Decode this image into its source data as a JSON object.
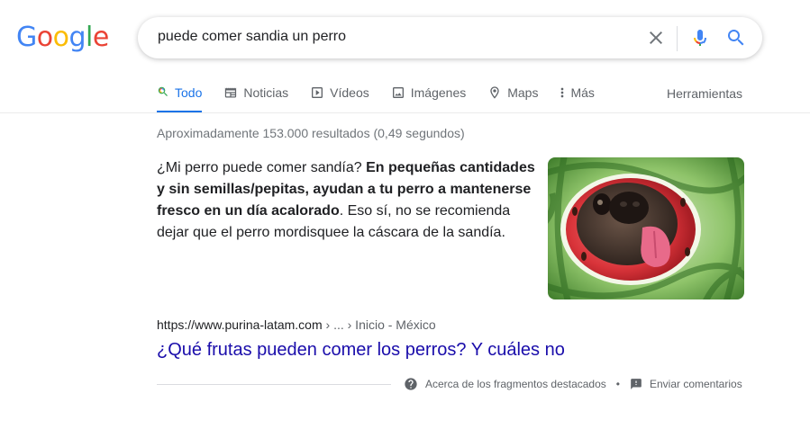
{
  "logo": {
    "text": "Google",
    "letters": [
      {
        "ch": "G",
        "color": "#4285F4"
      },
      {
        "ch": "o",
        "color": "#EA4335"
      },
      {
        "ch": "o",
        "color": "#FBBC05"
      },
      {
        "ch": "g",
        "color": "#4285F4"
      },
      {
        "ch": "l",
        "color": "#34A853"
      },
      {
        "ch": "e",
        "color": "#EA4335"
      }
    ]
  },
  "search": {
    "query": "puede comer sandia un perro"
  },
  "tabs": [
    {
      "label": "Todo",
      "icon": "search-icon",
      "active": true
    },
    {
      "label": "Noticias",
      "icon": "news-icon",
      "active": false
    },
    {
      "label": "Vídeos",
      "icon": "video-icon",
      "active": false
    },
    {
      "label": "Imágenes",
      "icon": "image-icon",
      "active": false
    },
    {
      "label": "Maps",
      "icon": "map-pin-icon",
      "active": false
    },
    {
      "label": "Más",
      "icon": "more-vert-icon",
      "active": false
    }
  ],
  "tools_label": "Herramientas",
  "stats": "Aproximadamente 153.000 resultados (0,49 segundos)",
  "snippet": {
    "lead": "¿Mi perro puede comer sandía? ",
    "bold": "En pequeñas cantidades y sin semillas/pepitas, ayudan a tu perro a mantenerse fresco en un día acalorado",
    "tail": ". Eso sí, no se recomienda dejar que el perro mordisquee la cáscara de la sandía."
  },
  "thumbnail": {
    "icon": "dog-in-watermelon-image"
  },
  "result": {
    "url": "https://www.purina-latam.com",
    "crumbs": " › ... › Inicio - México",
    "title": "¿Qué frutas pueden comer los perros? Y cuáles no"
  },
  "footer": {
    "about_label": "Acerca de los fragmentos destacados",
    "separator": "•",
    "feedback_label": "Enviar comentarios"
  },
  "colors": {
    "accent": "#1a73e8",
    "link": "#1a0dab",
    "muted": "#5f6368"
  }
}
